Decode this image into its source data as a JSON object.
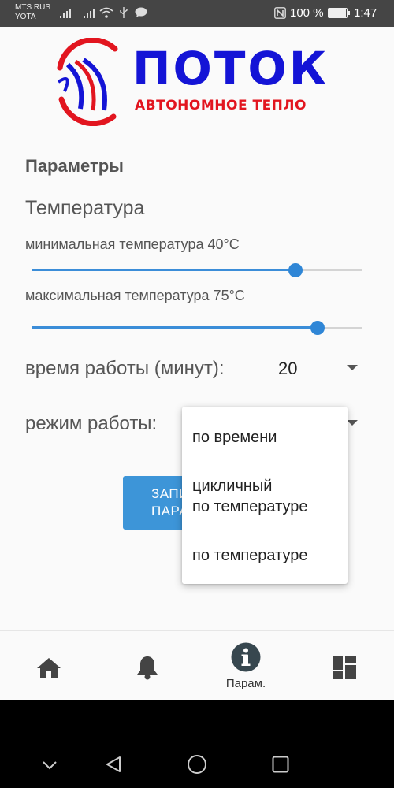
{
  "status_bar": {
    "carrier_1": "MTS RUS",
    "carrier_2": "YOTA",
    "battery_percent": "100 %",
    "battery_level": 1.0,
    "time": "1:47"
  },
  "logo": {
    "title": "ПОТОК",
    "subtitle": "АВТОНОМНОЕ ТЕПЛО",
    "colors": {
      "blue": "#1414d6",
      "red": "#e2151f"
    }
  },
  "params": {
    "heading": "Параметры",
    "temperature_heading": "Температура",
    "min_temp_label": "минимальная температура 40°C",
    "min_temp_slider_fraction": 0.8,
    "max_temp_label": "максимальная температура 75°C",
    "max_temp_slider_fraction": 0.867,
    "work_time_label": "время работы (минут):",
    "work_time_value": "20",
    "work_mode_label": "режим работы:",
    "save_button_label": "ЗАПИСАТЬ ПАРАМЕТРЫ",
    "save_button_visible": "ЗАП ПАРА"
  },
  "mode_menu": {
    "options": [
      "по времени",
      "цикличный\nпо температуре",
      "по температуре"
    ]
  },
  "bottom_nav": {
    "items": [
      {
        "icon": "home-icon",
        "label": ""
      },
      {
        "icon": "bell-icon",
        "label": ""
      },
      {
        "icon": "info-icon",
        "label": "Парам."
      },
      {
        "icon": "dashboard-icon",
        "label": ""
      }
    ]
  },
  "accent_color": "#3b8dd8"
}
